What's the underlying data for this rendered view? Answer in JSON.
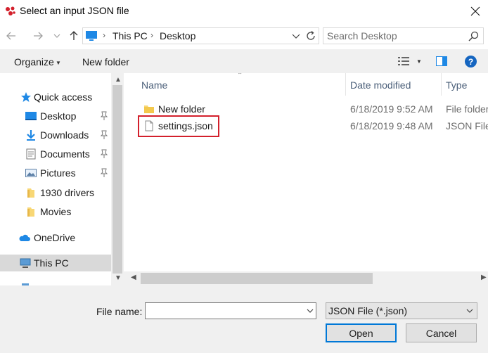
{
  "window": {
    "title": "Select an input JSON file",
    "close_glyph": "✕"
  },
  "address": {
    "crumbs": [
      "This PC",
      "Desktop"
    ],
    "separator": "›"
  },
  "search": {
    "placeholder": "Search Desktop"
  },
  "toolbar": {
    "organize_label": "Organize",
    "new_folder_label": "New folder"
  },
  "nav": {
    "quick_access": "Quick access",
    "items": [
      {
        "label": "Desktop",
        "icon": "desktop-icon",
        "pinned": true
      },
      {
        "label": "Downloads",
        "icon": "download-icon",
        "pinned": true
      },
      {
        "label": "Documents",
        "icon": "documents-icon",
        "pinned": true
      },
      {
        "label": "Pictures",
        "icon": "pictures-icon",
        "pinned": true
      },
      {
        "label": "1930 drivers",
        "icon": "folder-icon",
        "pinned": false
      },
      {
        "label": "Movies",
        "icon": "folder-icon",
        "pinned": false
      }
    ],
    "onedrive": "OneDrive",
    "this_pc": "This PC"
  },
  "columns": {
    "name": "Name",
    "date": "Date modified",
    "type": "Type"
  },
  "files": [
    {
      "name": "New folder",
      "date": "6/18/2019 9:52 AM",
      "type": "File folder",
      "icon": "folder-icon"
    },
    {
      "name": "settings.json",
      "date": "6/18/2019 9:48 AM",
      "type": "JSON File",
      "icon": "file-icon",
      "highlighted": true
    }
  ],
  "bottom": {
    "file_name_label": "File name:",
    "file_name_value": "",
    "file_type_value": "JSON File (*.json)",
    "open_label": "Open",
    "cancel_label": "Cancel"
  },
  "colors": {
    "highlight_border": "#d3202c",
    "accent": "#0078d7",
    "selected_nav": "#d9d9d9"
  }
}
